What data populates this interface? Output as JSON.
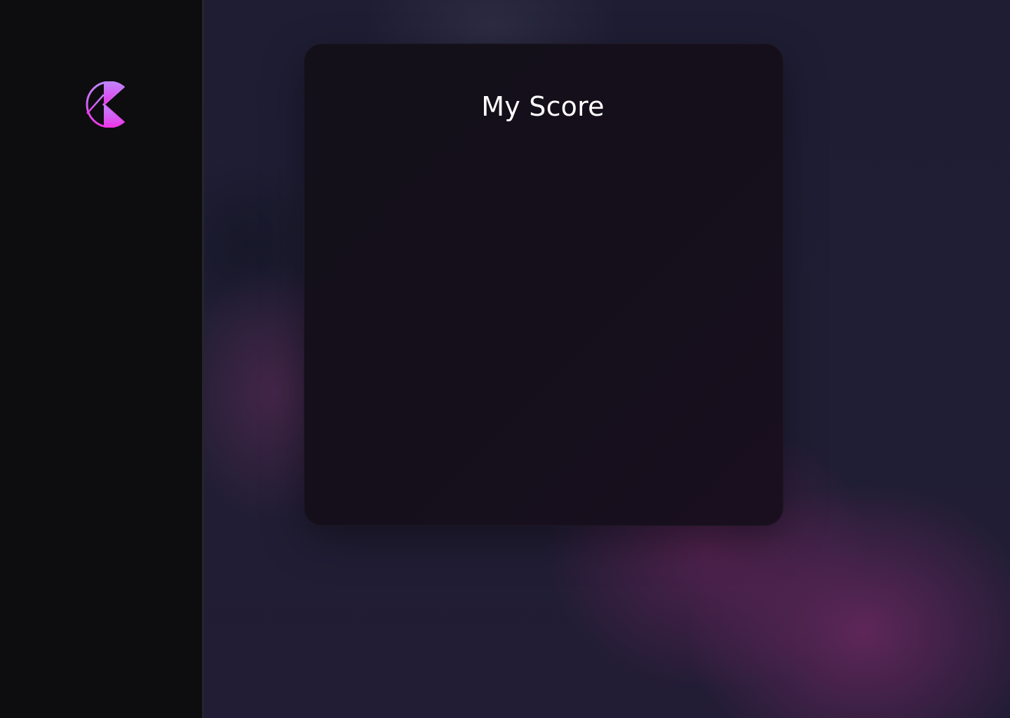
{
  "sidebar": {
    "logo_icon": "brand-logo-icon"
  },
  "score_card": {
    "title": "My Score"
  },
  "colors": {
    "brand_gradient_start": "#c084fc",
    "brand_gradient_end": "#f032e6",
    "sidebar_bg": "#0d0d10",
    "card_bg": "#140f1b"
  }
}
